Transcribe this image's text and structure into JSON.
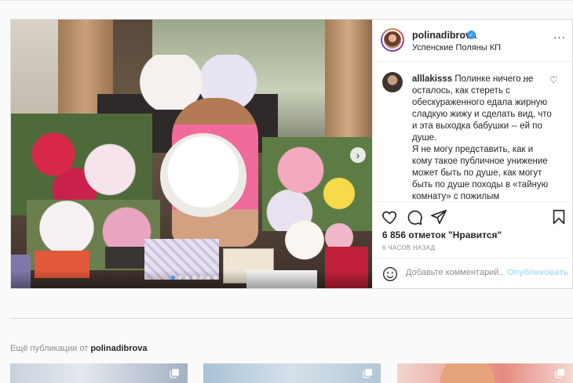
{
  "post": {
    "username": "polinadibrova",
    "location": "Успенские Поляны КП",
    "more_icon": "···",
    "carousel_dots": 7,
    "carousel_active_index": 0,
    "next_icon": "›"
  },
  "comment": {
    "username": "alllakisss",
    "paragraphs": [
      "Полинке ничего не осталось, как стереть с обескураженного едала жирную сладкую жижу и сделать вид, что и эта выходка бабушки -- ей по душе.",
      "Я не могу представить, как и кому такое публичное унижение может быть по душе, как могут быть по душе походы в «тайную комнату» с пожилым господином, который называет"
    ],
    "more_icon": "···",
    "heart_icon": "♡"
  },
  "actions": {
    "likes_text": "6 856 отметок \"Нравится\"",
    "time_ago": "6 ЧАСОВ НАЗАД"
  },
  "add_comment": {
    "placeholder": "Добавьте комментарий...",
    "publish_label": "Опубликовать"
  },
  "more_posts": {
    "prefix": "Ещё публикации от",
    "username": "polinadibrova"
  },
  "colors": {
    "accent": "#3897f0",
    "publish_disabled": "#b2dffc",
    "muted": "#8e8e8e"
  }
}
